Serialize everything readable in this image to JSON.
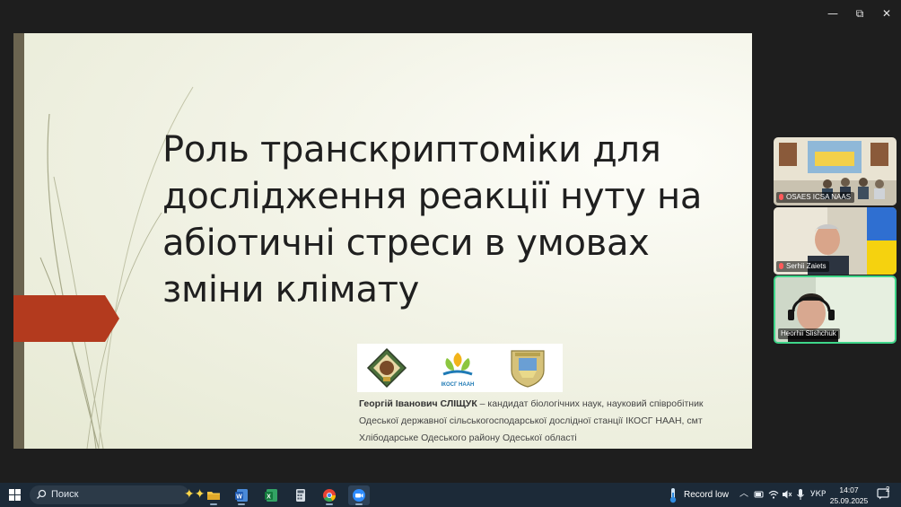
{
  "window": {
    "minimize_glyph": "—",
    "maximize_glyph": "⧉",
    "close_glyph": "✕"
  },
  "slide": {
    "title": "Роль транскриптоміки для дослідження реакції нуту на абіотичні стреси в умовах зміни клімату",
    "logos": [
      "emblem-logo",
      "ikosg-naan-logo",
      "institute-crest-logo"
    ],
    "logo2_caption": "ІКОСГ НААН",
    "author_name": "Георгій Іванович СЛІЩУК",
    "author_rest": " – кандидат біологічних наук, науковий співробітник Одеської державної сільськогосподарської дослідної станції ІКОСГ НААН, смт Хлібодарське Одеського району Одеської області",
    "accent_color": "#b33a1e",
    "bar_color": "#6b6450"
  },
  "participants": [
    {
      "name": "OSAES ICSA NAAS",
      "muted": true
    },
    {
      "name": "Serhii Zaiets",
      "muted": true
    },
    {
      "name": "Heorhii Slishchuk",
      "muted": false,
      "active_speaker": true
    }
  ],
  "taskbar": {
    "search_placeholder": "Поиск",
    "apps": [
      "file-explorer",
      "word",
      "excel",
      "calculator",
      "chrome",
      "zoom"
    ],
    "active_app": "zoom",
    "weather_label": "Record low",
    "language": "УКР",
    "time": "14:07",
    "date": "25.09.2025",
    "notification_count": "2"
  }
}
